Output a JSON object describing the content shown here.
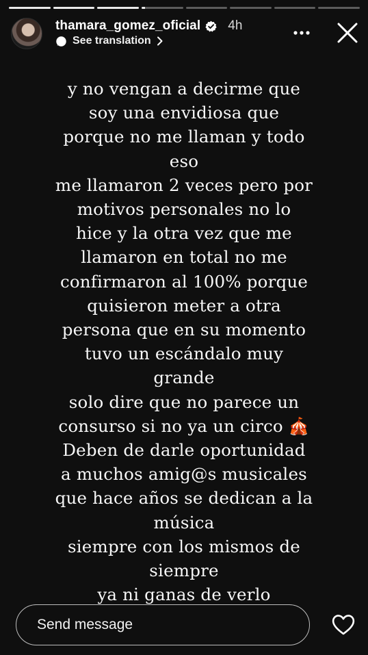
{
  "story": {
    "progress_segments": [
      1,
      1,
      1,
      0.08,
      0,
      0,
      0,
      0
    ]
  },
  "header": {
    "username": "thamara_gomez_oficial",
    "time": "4h",
    "translate_label": "See translation"
  },
  "text_lines": [
    "y no vengan a decirme que",
    "soy una envidiosa que",
    "porque no me llaman y todo",
    "eso",
    "me llamaron 2 veces pero por",
    "motivos personales no lo",
    "hice y la otra vez que me",
    "llamaron en total no me",
    "confirmaron al 100% porque",
    "quisieron meter a otra",
    "persona que en su momento",
    "tuvo un escándalo muy",
    "grande",
    "solo dire que no parece un",
    "consurso si no ya un circo 🎪",
    "Deben de darle oportunidad",
    "a muchos amig@s  musicales",
    "que hace años se dedican a la",
    "música",
    "siempre con los mismos de",
    "siempre",
    "ya ni ganas de verlo"
  ],
  "footer": {
    "placeholder": "Send message"
  }
}
